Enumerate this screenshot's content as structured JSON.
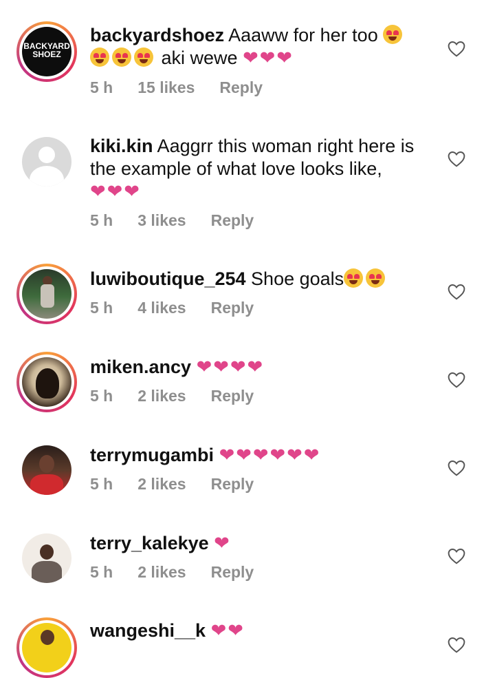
{
  "comments": [
    {
      "username": "backyardshoez",
      "text_before": " Aaaww for her too ",
      "text_after": " aki wewe ",
      "hearts": "❤❤❤",
      "time": "5 h",
      "likes": "15 likes",
      "reply": "Reply",
      "avatar_logo": "BACKYARD SHOEZ"
    },
    {
      "username": "kiki.kin",
      "text": " Aaggrr this woman right here is the example of what love looks like,",
      "hearts": "❤❤❤",
      "time": "5 h",
      "likes": "3 likes",
      "reply": "Reply"
    },
    {
      "username": "luwiboutique_254",
      "text": " Shoe goals",
      "time": "5 h",
      "likes": "4 likes",
      "reply": "Reply"
    },
    {
      "username": "miken.ancy",
      "hearts": "❤❤❤❤",
      "time": "5 h",
      "likes": "2 likes",
      "reply": "Reply"
    },
    {
      "username": "terrymugambi",
      "hearts": "❤❤❤❤❤❤",
      "time": "5 h",
      "likes": "2 likes",
      "reply": "Reply"
    },
    {
      "username": "terry_kalekye",
      "hearts": "❤",
      "time": "5 h",
      "likes": "2 likes",
      "reply": "Reply"
    },
    {
      "username": "wangeshi__k",
      "hearts": "❤❤"
    }
  ],
  "colors": {
    "heart_pink": "#e0458a",
    "meta_gray": "#8e8e8e",
    "story_ring": "#e2345c"
  },
  "icons": {
    "like": "heart-outline-icon",
    "emoji": "heart-eyes-emoji"
  }
}
